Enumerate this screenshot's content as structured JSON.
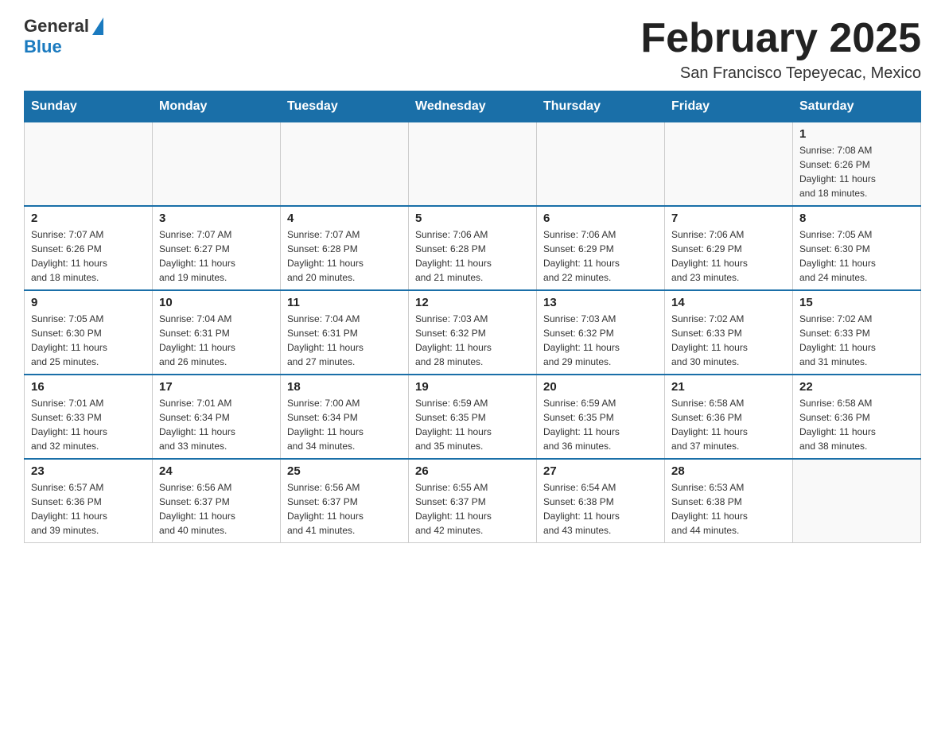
{
  "header": {
    "logo": {
      "general": "General",
      "blue": "Blue"
    },
    "title": "February 2025",
    "location": "San Francisco Tepeyecac, Mexico"
  },
  "weekdays": [
    "Sunday",
    "Monday",
    "Tuesday",
    "Wednesday",
    "Thursday",
    "Friday",
    "Saturday"
  ],
  "weeks": [
    [
      {
        "day": "",
        "info": ""
      },
      {
        "day": "",
        "info": ""
      },
      {
        "day": "",
        "info": ""
      },
      {
        "day": "",
        "info": ""
      },
      {
        "day": "",
        "info": ""
      },
      {
        "day": "",
        "info": ""
      },
      {
        "day": "1",
        "info": "Sunrise: 7:08 AM\nSunset: 6:26 PM\nDaylight: 11 hours\nand 18 minutes."
      }
    ],
    [
      {
        "day": "2",
        "info": "Sunrise: 7:07 AM\nSunset: 6:26 PM\nDaylight: 11 hours\nand 18 minutes."
      },
      {
        "day": "3",
        "info": "Sunrise: 7:07 AM\nSunset: 6:27 PM\nDaylight: 11 hours\nand 19 minutes."
      },
      {
        "day": "4",
        "info": "Sunrise: 7:07 AM\nSunset: 6:28 PM\nDaylight: 11 hours\nand 20 minutes."
      },
      {
        "day": "5",
        "info": "Sunrise: 7:06 AM\nSunset: 6:28 PM\nDaylight: 11 hours\nand 21 minutes."
      },
      {
        "day": "6",
        "info": "Sunrise: 7:06 AM\nSunset: 6:29 PM\nDaylight: 11 hours\nand 22 minutes."
      },
      {
        "day": "7",
        "info": "Sunrise: 7:06 AM\nSunset: 6:29 PM\nDaylight: 11 hours\nand 23 minutes."
      },
      {
        "day": "8",
        "info": "Sunrise: 7:05 AM\nSunset: 6:30 PM\nDaylight: 11 hours\nand 24 minutes."
      }
    ],
    [
      {
        "day": "9",
        "info": "Sunrise: 7:05 AM\nSunset: 6:30 PM\nDaylight: 11 hours\nand 25 minutes."
      },
      {
        "day": "10",
        "info": "Sunrise: 7:04 AM\nSunset: 6:31 PM\nDaylight: 11 hours\nand 26 minutes."
      },
      {
        "day": "11",
        "info": "Sunrise: 7:04 AM\nSunset: 6:31 PM\nDaylight: 11 hours\nand 27 minutes."
      },
      {
        "day": "12",
        "info": "Sunrise: 7:03 AM\nSunset: 6:32 PM\nDaylight: 11 hours\nand 28 minutes."
      },
      {
        "day": "13",
        "info": "Sunrise: 7:03 AM\nSunset: 6:32 PM\nDaylight: 11 hours\nand 29 minutes."
      },
      {
        "day": "14",
        "info": "Sunrise: 7:02 AM\nSunset: 6:33 PM\nDaylight: 11 hours\nand 30 minutes."
      },
      {
        "day": "15",
        "info": "Sunrise: 7:02 AM\nSunset: 6:33 PM\nDaylight: 11 hours\nand 31 minutes."
      }
    ],
    [
      {
        "day": "16",
        "info": "Sunrise: 7:01 AM\nSunset: 6:33 PM\nDaylight: 11 hours\nand 32 minutes."
      },
      {
        "day": "17",
        "info": "Sunrise: 7:01 AM\nSunset: 6:34 PM\nDaylight: 11 hours\nand 33 minutes."
      },
      {
        "day": "18",
        "info": "Sunrise: 7:00 AM\nSunset: 6:34 PM\nDaylight: 11 hours\nand 34 minutes."
      },
      {
        "day": "19",
        "info": "Sunrise: 6:59 AM\nSunset: 6:35 PM\nDaylight: 11 hours\nand 35 minutes."
      },
      {
        "day": "20",
        "info": "Sunrise: 6:59 AM\nSunset: 6:35 PM\nDaylight: 11 hours\nand 36 minutes."
      },
      {
        "day": "21",
        "info": "Sunrise: 6:58 AM\nSunset: 6:36 PM\nDaylight: 11 hours\nand 37 minutes."
      },
      {
        "day": "22",
        "info": "Sunrise: 6:58 AM\nSunset: 6:36 PM\nDaylight: 11 hours\nand 38 minutes."
      }
    ],
    [
      {
        "day": "23",
        "info": "Sunrise: 6:57 AM\nSunset: 6:36 PM\nDaylight: 11 hours\nand 39 minutes."
      },
      {
        "day": "24",
        "info": "Sunrise: 6:56 AM\nSunset: 6:37 PM\nDaylight: 11 hours\nand 40 minutes."
      },
      {
        "day": "25",
        "info": "Sunrise: 6:56 AM\nSunset: 6:37 PM\nDaylight: 11 hours\nand 41 minutes."
      },
      {
        "day": "26",
        "info": "Sunrise: 6:55 AM\nSunset: 6:37 PM\nDaylight: 11 hours\nand 42 minutes."
      },
      {
        "day": "27",
        "info": "Sunrise: 6:54 AM\nSunset: 6:38 PM\nDaylight: 11 hours\nand 43 minutes."
      },
      {
        "day": "28",
        "info": "Sunrise: 6:53 AM\nSunset: 6:38 PM\nDaylight: 11 hours\nand 44 minutes."
      },
      {
        "day": "",
        "info": ""
      }
    ]
  ]
}
